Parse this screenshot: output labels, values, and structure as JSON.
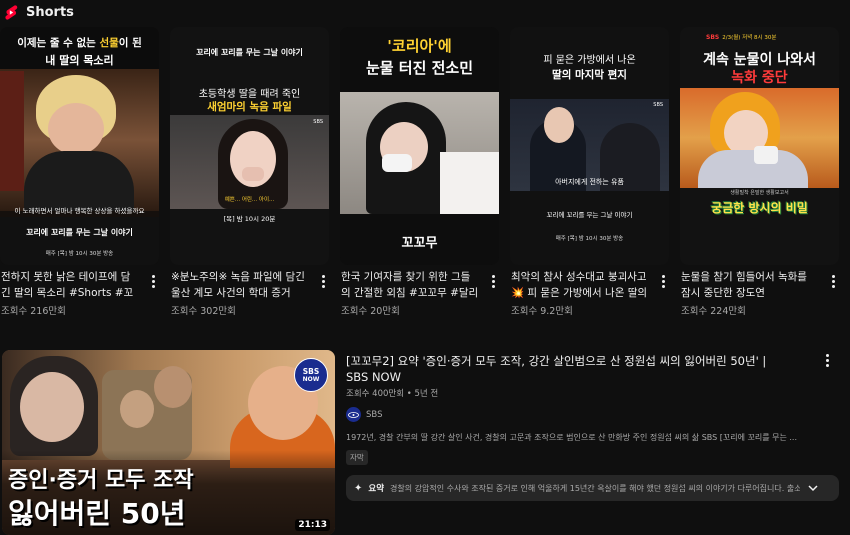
{
  "shorts_header": {
    "title": "Shorts",
    "icon": "shorts-logo-icon"
  },
  "shorts": [
    {
      "title": "전하지 못한 낡은 테이프에 담긴 딸의 목소리 #Shorts #꼬꼬무",
      "views": "조회수 216만회",
      "thumb_text_top": "이제는 줄 수 없는 ",
      "thumb_text_highlight": "선물",
      "thumb_text_top_end": "이 된",
      "thumb_text_bottom": "내 딸의 목소리",
      "thumb_subtitle": "이 노래하면서 얼마나 행복한 상상을 하셨을까요",
      "thumb_logo": "꼬리에 꼬리를 무는 그날 이야기",
      "thumb_schedule": "매주 [목] 밤 10시 30분 방송"
    },
    {
      "title": "※분노주의※ 녹음 파일에 담긴 울산 계모 사건의 학대 증거",
      "views": "조회수 302만회",
      "thumb_logo": "꼬리에 꼬리를 무는 그날 이야기",
      "thumb_text_top": "초등학생 딸을 때려 죽인",
      "thumb_text_bottom": "새엄마의 녹음 파일",
      "thumb_subtitle": "예쁜... 어린... 아이...",
      "thumb_schedule": "[목] 밤 10시 20분",
      "thumb_network": "SBS"
    },
    {
      "title": "한국 기여자를 찾기 위한 그들의 간절한 외침 #꼬꼬무 #달리기",
      "views": "조회수 20만회",
      "thumb_text_top": "'코리아'에",
      "thumb_text_bottom": "눈물 터진 전소민",
      "thumb_logo": "꼬꼬무"
    },
    {
      "title": "최악의 참사 성수대교 붕괴사고💥 피 묻은 가방에서 나온 딸의 편지",
      "views": "조회수 9.2만회",
      "thumb_text_top": "피 묻은 가방에서 나온",
      "thumb_text_bottom": "딸의 마지막 편지",
      "thumb_subtitle": "아버지에게 전하는 유품",
      "thumb_logo": "꼬리에 꼬리를 무는 그날 이야기",
      "thumb_schedule": "매주 [목] 밤 10시 30분 방송",
      "thumb_network": "SBS"
    },
    {
      "title": "눈물을 참기 힘들어서 녹화를 잠시 중단한 장도연",
      "views": "조회수 224만회",
      "thumb_badge": "SBS",
      "thumb_badge_schedule": "2/3(월) 저녁 8시 30분",
      "thumb_text_top": "계속 눈물이 나와서",
      "thumb_text_bottom": "녹화 중단",
      "thumb_logo_small": "생활밀착 은밀한 생활보고서",
      "thumb_logo": "궁금한 방시의 비밀"
    }
  ],
  "video": {
    "title": "[꼬꼬무2] 요약 '증인·증거 모두 조작, 강간 살인범으로 산 정원섭 씨의 잃어버린 50년' | SBS NOW",
    "views": "조회수 400만회",
    "age": "5년 전",
    "channel": "SBS",
    "description": "1972년, 경찰 간부의 딸 강간 살인 사건, 경찰의 고문과 조작으로 범인으로 산 만화방 주인 정원섭 씨의 삶 SBS [꼬리에 꼬리를 무는 ...",
    "badge": "자막",
    "summary_label": "요약",
    "summary_text": "경찰의 강압적인 수사와 조작된 증거로 인해 억울하게 15년간 옥살이를 해야 했던 정원섭 씨의 이야기가 다루어집니다. 출소 후...",
    "duration": "21:13",
    "thumb_caption_line1": "증인·증거 모두 조작",
    "thumb_caption_line2": "잃어버린 50년",
    "thumb_badge_top": "SBS",
    "thumb_badge_bottom": "NOW"
  },
  "colors": {
    "background": "#0f0f0f",
    "accent_red": "#ff0033",
    "secondary_text": "#aaaaaa",
    "highlight_yellow": "#ffd232",
    "sbs_blue": "#1a2c8f"
  }
}
